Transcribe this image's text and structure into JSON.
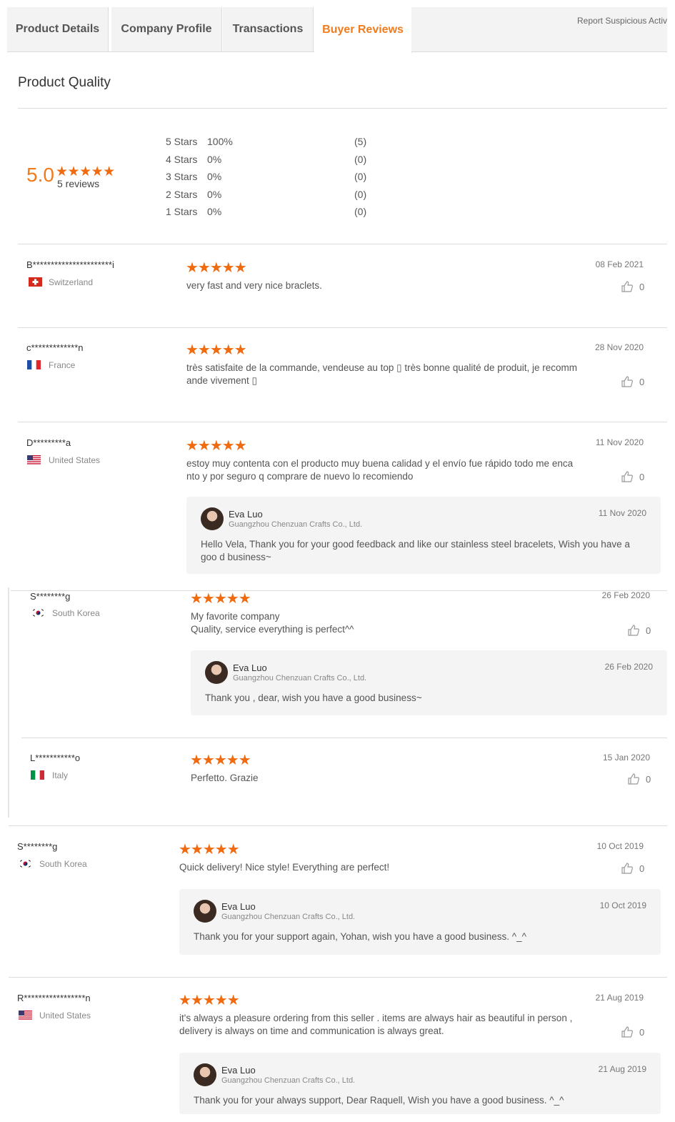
{
  "tabs": [
    {
      "label": "Product Details"
    },
    {
      "label": "Company Profile"
    },
    {
      "label": "Transactions"
    },
    {
      "label": "Buyer Reviews"
    }
  ],
  "report_link": "Report Suspicious Activity",
  "section_title": "Product Quality",
  "summary": {
    "score": "5.0",
    "stars": "★★★★★",
    "rating": 5,
    "reviews_label": "5 reviews"
  },
  "distribution": [
    {
      "label": "5  Stars",
      "percent": "100%",
      "count": "(5)"
    },
    {
      "label": "4  Stars",
      "percent": "0%",
      "count": "(0)"
    },
    {
      "label": "3  Stars",
      "percent": "0%",
      "count": "(0)"
    },
    {
      "label": "2  Stars",
      "percent": "0%",
      "count": "(0)"
    },
    {
      "label": "1  Stars",
      "percent": "0%",
      "count": "(0)"
    }
  ],
  "reviews": [
    {
      "name": "B**********************i",
      "country": "Switzerland",
      "flag": "ch",
      "stars": "★★★★★",
      "rating": 5,
      "text": "very fast and very nice braclets.",
      "date": "08 Feb 2021",
      "likes": "0"
    },
    {
      "name": "c*************n",
      "country": "France",
      "flag": "fr",
      "stars": "★★★★★",
      "rating": 5,
      "text": "très satisfaite de la commande, vendeuse au top ▯ très bonne qualité de produit, je recomm ande vivement ▯",
      "date": "28 Nov 2020",
      "likes": "0"
    },
    {
      "name": "D*********a",
      "country": "United States",
      "flag": "us",
      "stars": "★★★★★",
      "rating": 5,
      "text": "estoy muy contenta con el producto muy buena  calidad y el envío fue rápido  todo me enca nto y por seguro q comprare de nuevo lo recomiendo",
      "date": "11 Nov 2020",
      "likes": "0",
      "reply": {
        "name": "Eva Luo",
        "company": "Guangzhou Chenzuan Crafts Co., Ltd.",
        "date": "11 Nov 2020",
        "text": "Hello Vela, Thank you for your good feedback and like our stainless steel bracelets, Wish you have a goo d business~"
      }
    },
    {
      "name": "S********g",
      "country": "South Korea",
      "flag": "kr",
      "stars": "★★★★★",
      "rating": 5,
      "text": "My favorite company\nQuality, service everything is perfect^^",
      "date": "26 Feb 2020",
      "likes": "0",
      "reply": {
        "name": "Eva Luo",
        "company": "Guangzhou Chenzuan Crafts Co., Ltd.",
        "date": "26 Feb 2020",
        "text": "Thank you , dear, wish you have a good business~"
      }
    },
    {
      "name": "L***********o",
      "country": "Italy",
      "flag": "it",
      "stars": "★★★★★",
      "rating": 5,
      "text": "Perfetto. Grazie",
      "date": "15 Jan 2020",
      "likes": "0"
    },
    {
      "name": "S********g",
      "country": "South Korea",
      "flag": "kr",
      "stars": "★★★★★",
      "rating": 5,
      "text": "Quick delivery! Nice style! Everything are perfect!",
      "date": "10 Oct 2019",
      "likes": "0",
      "reply": {
        "name": "Eva Luo",
        "company": "Guangzhou Chenzuan Crafts Co., Ltd.",
        "date": "10 Oct 2019",
        "text": "Thank you for your support again, Yohan, wish you have a good business. ^_^"
      }
    },
    {
      "name": "R*****************n",
      "country": "United States",
      "flag": "us",
      "stars": "★★★★★",
      "rating": 5,
      "text": "it's always a pleasure ordering from this seller . items are always hair as beautiful  in person , delivery is always on time and communication is always great.",
      "date": "21 Aug 2019",
      "likes": "0",
      "reply": {
        "name": "Eva Luo",
        "company": "Guangzhou Chenzuan Crafts Co., Ltd.",
        "date": "21 Aug 2019",
        "text": "Thank you for your always support, Dear Raquell, Wish you have a good business. ^_^"
      }
    }
  ]
}
